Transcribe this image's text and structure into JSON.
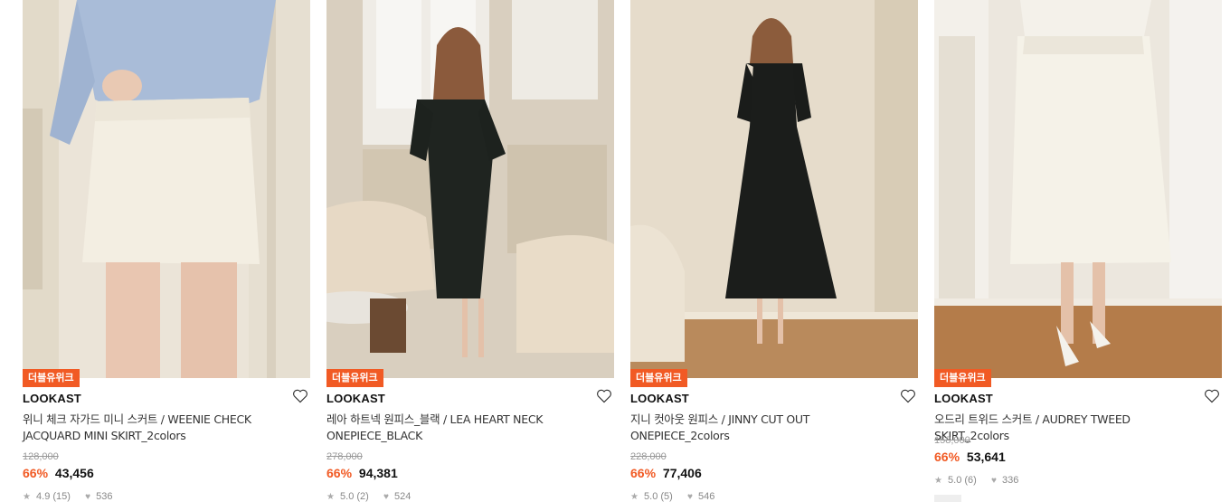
{
  "products": [
    {
      "badge": "더블유위크",
      "brand": "LOOKAST",
      "name": "위니 체크 자가드 미니 스커트 / WEENIE CHECK JACQUARD MINI SKIRT_2colors",
      "original_price": "128,000",
      "discount": "66%",
      "sale_price": "43,456",
      "rating": "4.9",
      "review_count": "(15)",
      "likes": "536",
      "wishlist_icon": "heart-outline-icon"
    },
    {
      "badge": "더블유위크",
      "brand": "LOOKAST",
      "name": "레아 하트넥 원피스_블랙 / LEA HEART NECK ONEPIECE_BLACK",
      "original_price": "278,000",
      "discount": "66%",
      "sale_price": "94,381",
      "rating": "5.0",
      "review_count": "(2)",
      "likes": "524",
      "wishlist_icon": "heart-outline-icon"
    },
    {
      "badge": "더블유위크",
      "brand": "LOOKAST",
      "name": "지니 컷아웃 원피스 / JINNY CUT OUT ONEPIECE_2colors",
      "original_price": "228,000",
      "discount": "66%",
      "sale_price": "77,406",
      "rating": "5.0",
      "review_count": "(5)",
      "likes": "546",
      "wishlist_icon": "heart-outline-icon"
    },
    {
      "badge": "더블유위크",
      "brand": "LOOKAST",
      "name": "오드리 트위드 스커트 / AUDREY TWEED SKIRT_2colors",
      "original_price": "158,000",
      "discount": "66%",
      "sale_price": "53,641",
      "rating": "5.0",
      "review_count": "(6)",
      "likes": "336",
      "wishlist_icon": "heart-outline-icon"
    }
  ],
  "colors": {
    "accent": "#f15a24",
    "muted": "#999999"
  }
}
